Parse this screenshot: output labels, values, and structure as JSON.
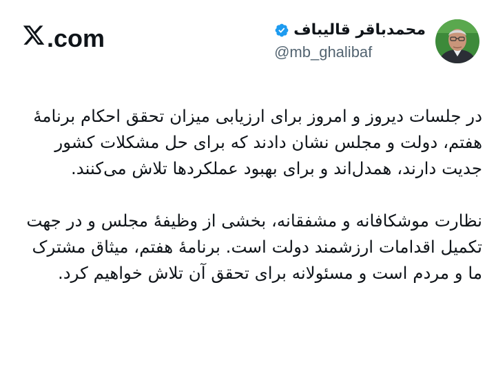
{
  "brand": {
    "label": ".com",
    "logo_icon": "x-logo-icon"
  },
  "author": {
    "display_name": "محمدباقر قالیباف",
    "handle": "@mb_ghalibaf",
    "verified_icon": "verified-badge-icon",
    "badge_color": "#1d9bf0"
  },
  "tweet": {
    "paragraphs": [
      "در جلسات دیروز و امروز برای ارزیابی میزان تحقق احکام برنامهٔ هفتم، دولت و مجلس نشان دادند که برای حل مشکلات کشور جدیت دارند، همدل‌اند و برای بهبود عملکردها تلاش می‌کنند.",
      "نظارت موشکافانه و مشفقانه، بخشی از وظیفهٔ مجلس و در جهت تکمیل اقدامات ارزشمند دولت است. برنامهٔ هفتم، میثاق مشترک ما و مردم است و مسئولانه برای تحقق آن تلاش خواهیم کرد."
    ]
  }
}
